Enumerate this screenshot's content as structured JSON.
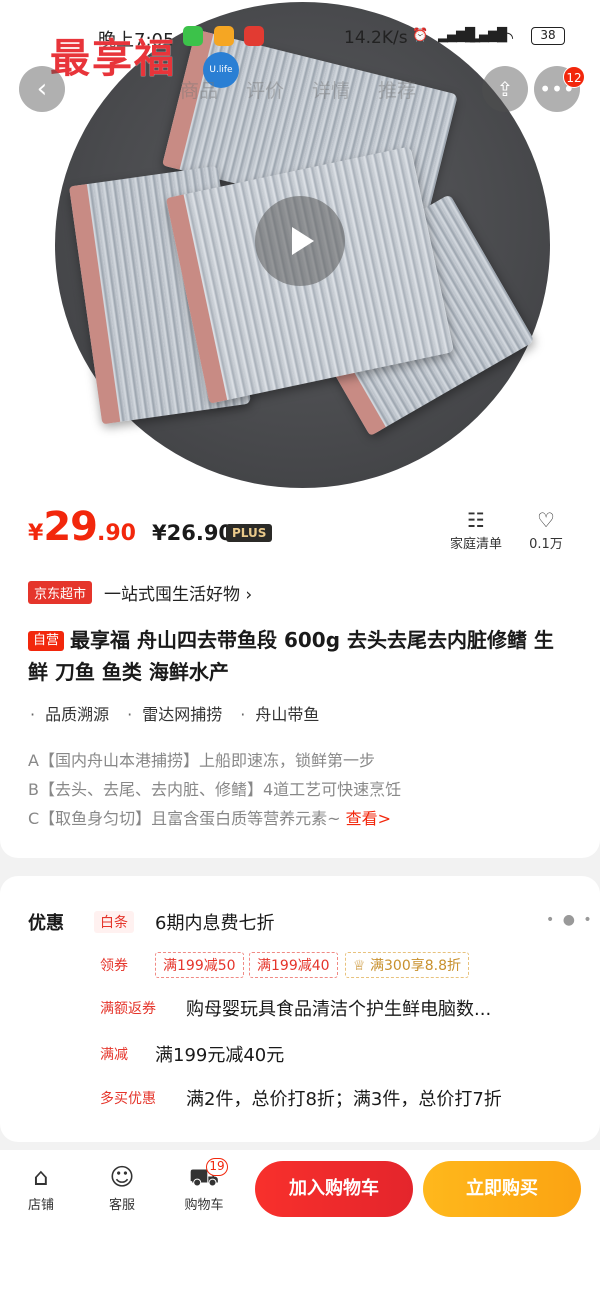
{
  "status_bar": {
    "time": "晚上7:05",
    "net_speed": "14.2K/s",
    "signal": "HD",
    "battery": "38"
  },
  "header": {
    "brand_logo": "最享福",
    "brand_sub": "U.life",
    "tabs": [
      "商品",
      "评价",
      "详情",
      "推荐"
    ],
    "notification_count": "12"
  },
  "product": {
    "price_yen": "¥",
    "price_int": "29",
    "price_dec": ".90",
    "plus_price": "¥26.90",
    "plus_tag": "PLUS",
    "family_list": "家庭清单",
    "favorites": "0.1万",
    "jd_tag": "京东超市",
    "jd_slogan": "一站式囤生活好物 ›",
    "self_tag": "自营",
    "title": "最享福 舟山四去带鱼段 600g  去头去尾去内脏修鳍 生鲜 刀鱼 鱼类 海鲜水产",
    "tags": [
      "品质溯源",
      "雷达网捕捞",
      "舟山带鱼"
    ],
    "desc": [
      "A【国内舟山本港捕捞】上船即速冻，锁鲜第一步",
      "B【去头、去尾、去内脏、修鳍】4道工艺可快速烹饪",
      "C【取鱼身匀切】且富含蛋白质等营养元素~ "
    ],
    "desc_more": "查看>"
  },
  "promo": {
    "title": "优惠",
    "baitiao_label": "白条",
    "baitiao_text": "6期内息费七折",
    "coupon_label": "领券",
    "coupons": [
      "满199减50",
      "满199减40",
      "满300享8.8折"
    ],
    "fanquan_label": "满额返券",
    "fanquan_text": "购母婴玩具食品清洁个护生鲜电脑数...",
    "manjian_label": "满减",
    "manjian_text": "满199元减40元",
    "duomai_label": "多买优惠",
    "duomai_text": "满2件，总价打8折；满3件，总价打7折"
  },
  "bottom_bar": {
    "store": "店铺",
    "service": "客服",
    "cart": "购物车",
    "cart_count": "19",
    "add_to_cart": "加入购物车",
    "buy_now": "立即购买"
  }
}
